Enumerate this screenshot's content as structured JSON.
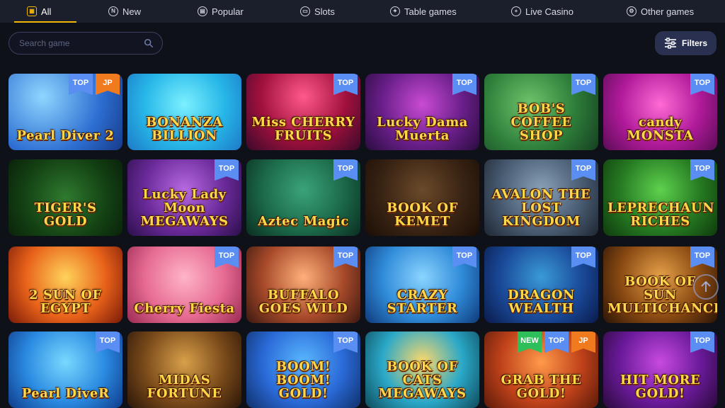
{
  "tabs": [
    {
      "label": "All",
      "icon": "grid-icon",
      "active": true
    },
    {
      "label": "New",
      "icon": "new-n-icon"
    },
    {
      "label": "Popular",
      "icon": "popular-icon"
    },
    {
      "label": "Slots",
      "icon": "slots-icon"
    },
    {
      "label": "Table games",
      "icon": "table-games-icon"
    },
    {
      "label": "Live Casino",
      "icon": "live-casino-icon"
    },
    {
      "label": "Other games",
      "icon": "other-games-icon"
    }
  ],
  "search": {
    "placeholder": "Search game"
  },
  "filters": {
    "label": "Filters"
  },
  "colors": {
    "accent": "#f2b705",
    "badge_top": "#5b8ef2",
    "badge_jp": "#f07b1e",
    "badge_new": "#2fbf5a"
  },
  "games": [
    {
      "title": "Pearl Diver 2",
      "badges": [
        "TOP",
        "JP"
      ]
    },
    {
      "title": "BONANZA BILLION",
      "badges": []
    },
    {
      "title": "Miss CHERRY FRUITS",
      "badges": [
        "TOP"
      ]
    },
    {
      "title": "Lucky Dama Muerta",
      "badges": [
        "TOP"
      ]
    },
    {
      "title": "BOB'S COFFEE SHOP",
      "badges": [
        "TOP"
      ]
    },
    {
      "title": "candy MONSTA",
      "badges": [
        "TOP"
      ]
    },
    {
      "title": "TIGER'S GOLD",
      "badges": []
    },
    {
      "title": "Lucky Lady Moon MEGAWAYS",
      "badges": [
        "TOP"
      ]
    },
    {
      "title": "Aztec Magic",
      "badges": [
        "TOP"
      ]
    },
    {
      "title": "BOOK OF KEMET",
      "badges": []
    },
    {
      "title": "AVALON THE LOST KINGDOM",
      "badges": [
        "TOP"
      ]
    },
    {
      "title": "LEPRECHAUN RICHES",
      "badges": [
        "TOP"
      ]
    },
    {
      "title": "2 SUN OF EGYPT",
      "badges": []
    },
    {
      "title": "Cherry Fiesta",
      "badges": [
        "TOP"
      ]
    },
    {
      "title": "BUFFALO GOES WILD",
      "badges": [
        "TOP"
      ]
    },
    {
      "title": "CRAZY STARTER",
      "badges": [
        "TOP"
      ]
    },
    {
      "title": "DRAGON WEALTH",
      "badges": [
        "TOP"
      ]
    },
    {
      "title": "BOOK OF SUN MULTICHANCE",
      "badges": [
        "TOP"
      ]
    },
    {
      "title": "Pearl DiveR",
      "badges": [
        "TOP"
      ]
    },
    {
      "title": "MIDAS FORTUNE",
      "badges": []
    },
    {
      "title": "BOOM! BOOM! GOLD!",
      "badges": [
        "TOP"
      ]
    },
    {
      "title": "BOOK OF CATS MEGAWAYS",
      "badges": []
    },
    {
      "title": "GRAB THE GOLD!",
      "badges": [
        "NEW",
        "TOP",
        "JP"
      ]
    },
    {
      "title": "HIT MORE GOLD!",
      "badges": [
        "TOP"
      ]
    }
  ]
}
